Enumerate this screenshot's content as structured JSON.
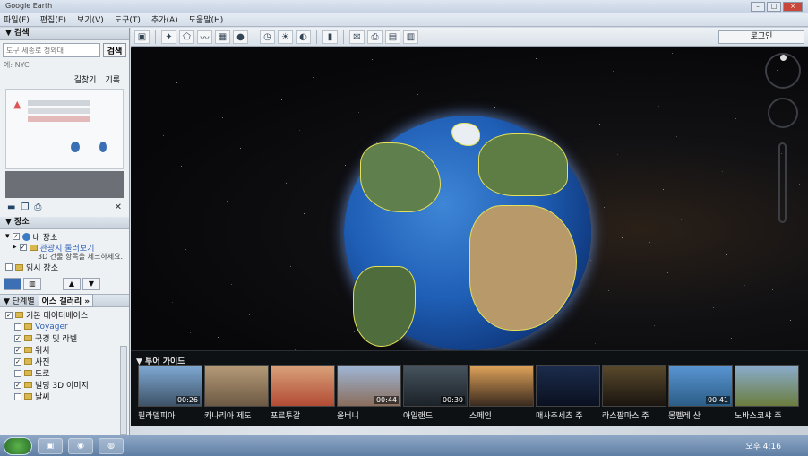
{
  "window": {
    "title": "Google Earth",
    "controls": [
      "–",
      "□",
      "×"
    ]
  },
  "menu": [
    "파일(F)",
    "편집(E)",
    "보기(V)",
    "도구(T)",
    "추가(A)",
    "도움말(H)"
  ],
  "toolbar": {
    "login_label": "로그인"
  },
  "search": {
    "header": "▼ 검색",
    "placeholder": "도구 세종로 청와대",
    "button": "검색",
    "recent": "예: NYC",
    "tab_directions": "길찾기",
    "tab_history": "기록"
  },
  "places": {
    "header": "▼ 장소",
    "my_places": "내 장소",
    "sightseeing": "관광지 둘러보기",
    "sightseeing_note": "3D 건물 항목을 체크하세요.",
    "temporary": "임시 장소"
  },
  "layers": {
    "header": "▼ 단계별",
    "gallery": "어스 갤러리 »",
    "items": [
      {
        "label": "기본 데이터베이스",
        "checked": true
      },
      {
        "label": "Voyager",
        "checked": false
      },
      {
        "label": "국경 및 라벨",
        "checked": true
      },
      {
        "label": "위치",
        "checked": true
      },
      {
        "label": "사진",
        "checked": true
      },
      {
        "label": "도로",
        "checked": false
      },
      {
        "label": "빌딩 3D 이미지",
        "checked": true
      },
      {
        "label": "날씨",
        "checked": false
      }
    ]
  },
  "tour": {
    "title": "▼ 투어 가이드",
    "items": [
      {
        "label": "필라델피아",
        "duration": "00:26",
        "c1": "#7fa9d3",
        "c2": "#3e5368"
      },
      {
        "label": "카나리아 제도",
        "duration": "",
        "c1": "#b59a77",
        "c2": "#6d5a44"
      },
      {
        "label": "포르투갈",
        "duration": "",
        "c1": "#d9a27a",
        "c2": "#b24b35"
      },
      {
        "label": "올버니",
        "duration": "00:44",
        "c1": "#9fb6d6",
        "c2": "#8a6e5c"
      },
      {
        "label": "아일랜드",
        "duration": "00:30",
        "c1": "#46535e",
        "c2": "#1c2228"
      },
      {
        "label": "스페인",
        "duration": "",
        "c1": "#e0a35a",
        "c2": "#3a2a1f"
      },
      {
        "label": "매사추세츠 주",
        "duration": "",
        "c1": "#1c2c4d",
        "c2": "#0a1020"
      },
      {
        "label": "라스팔마스 주",
        "duration": "",
        "c1": "#5a4a2c",
        "c2": "#1a1510"
      },
      {
        "label": "몽펠레 산",
        "duration": "00:41",
        "c1": "#5a95d3",
        "c2": "#2b5e86"
      },
      {
        "label": "노바스코샤 주",
        "duration": "",
        "c1": "#8aaccd",
        "c2": "#6b7d3e"
      }
    ]
  },
  "taskbar": {
    "clock": "오후 4:16"
  }
}
